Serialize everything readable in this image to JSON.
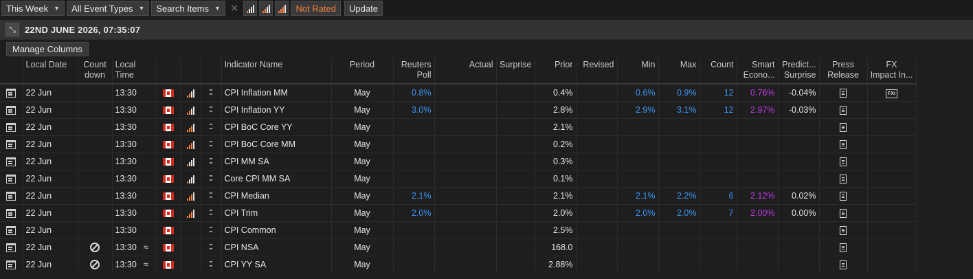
{
  "toolbar": {
    "range_label": "This Week",
    "events_label": "All Event Types",
    "search_label": "Search Items",
    "not_rated_label": "Not Rated",
    "update_label": "Update"
  },
  "datebar": {
    "datetime": "22ND JUNE 2026, 07:35:07"
  },
  "manage_columns_label": "Manage Columns",
  "colors": {
    "blue": "#3d93f0",
    "purple": "#c23de6",
    "orange": "#f2803a"
  },
  "columns": {
    "local_date": "Local Date",
    "countdown_1": "Count",
    "countdown_2": "down",
    "local_time_1": "Local",
    "local_time_2": "Time",
    "indicator": "Indicator Name",
    "period": "Period",
    "poll_1": "Reuters",
    "poll_2": "Poll",
    "actual": "Actual",
    "surprise": "Surprise",
    "prior": "Prior",
    "revised": "Revised",
    "min": "Min",
    "max": "Max",
    "count": "Count",
    "smart_1": "Smart",
    "smart_2": "Econo...",
    "pred_1": "Predict...",
    "pred_2": "Surprise",
    "press_1": "Press",
    "press_2": "Release",
    "fx_1": "FX",
    "fx_2": "Impact In...",
    "fx_icon_label": "FXi"
  },
  "rows": [
    {
      "date": "22 Jun",
      "countdown": "",
      "time": "13:30",
      "approx": "",
      "importance": 2,
      "indicator": "CPI Inflation MM",
      "period": "May",
      "poll": "0.8%",
      "actual": "",
      "surprise": "",
      "prior": "0.4%",
      "revised": "",
      "min": "0.6%",
      "max": "0.9%",
      "count": "12",
      "smart": "0.76%",
      "pred": "-0.04%",
      "fx": true
    },
    {
      "date": "22 Jun",
      "countdown": "",
      "time": "13:30",
      "approx": "",
      "importance": 2,
      "indicator": "CPI Inflation YY",
      "period": "May",
      "poll": "3.0%",
      "actual": "",
      "surprise": "",
      "prior": "2.8%",
      "revised": "",
      "min": "2.9%",
      "max": "3.1%",
      "count": "12",
      "smart": "2.97%",
      "pred": "-0.03%",
      "fx": false
    },
    {
      "date": "22 Jun",
      "countdown": "",
      "time": "13:30",
      "approx": "",
      "importance": 3,
      "indicator": "CPI BoC Core YY",
      "period": "May",
      "poll": "",
      "actual": "",
      "surprise": "",
      "prior": "2.1%",
      "revised": "",
      "min": "",
      "max": "",
      "count": "",
      "smart": "",
      "pred": "",
      "fx": false
    },
    {
      "date": "22 Jun",
      "countdown": "",
      "time": "13:30",
      "approx": "",
      "importance": 3,
      "indicator": "CPI BoC Core MM",
      "period": "May",
      "poll": "",
      "actual": "",
      "surprise": "",
      "prior": "0.2%",
      "revised": "",
      "min": "",
      "max": "",
      "count": "",
      "smart": "",
      "pred": "",
      "fx": false
    },
    {
      "date": "22 Jun",
      "countdown": "",
      "time": "13:30",
      "approx": "",
      "importance": 1,
      "indicator": "CPI MM SA",
      "period": "May",
      "poll": "",
      "actual": "",
      "surprise": "",
      "prior": "0.3%",
      "revised": "",
      "min": "",
      "max": "",
      "count": "",
      "smart": "",
      "pred": "",
      "fx": false
    },
    {
      "date": "22 Jun",
      "countdown": "",
      "time": "13:30",
      "approx": "",
      "importance": 1,
      "indicator": "Core CPI MM SA",
      "period": "May",
      "poll": "",
      "actual": "",
      "surprise": "",
      "prior": "0.1%",
      "revised": "",
      "min": "",
      "max": "",
      "count": "",
      "smart": "",
      "pred": "",
      "fx": false
    },
    {
      "date": "22 Jun",
      "countdown": "",
      "time": "13:30",
      "approx": "",
      "importance": 3,
      "indicator": "CPI Median",
      "period": "May",
      "poll": "2.1%",
      "actual": "",
      "surprise": "",
      "prior": "2.1%",
      "revised": "",
      "min": "2.1%",
      "max": "2.2%",
      "count": "6",
      "smart": "2.12%",
      "pred": "0.02%",
      "fx": false
    },
    {
      "date": "22 Jun",
      "countdown": "",
      "time": "13:30",
      "approx": "",
      "importance": 3,
      "indicator": "CPI Trim",
      "period": "May",
      "poll": "2.0%",
      "actual": "",
      "surprise": "",
      "prior": "2.0%",
      "revised": "",
      "min": "2.0%",
      "max": "2.0%",
      "count": "7",
      "smart": "2.00%",
      "pred": "0.00%",
      "fx": false
    },
    {
      "date": "22 Jun",
      "countdown": "",
      "time": "13:30",
      "approx": "",
      "importance": 0,
      "indicator": "CPI Common",
      "period": "May",
      "poll": "",
      "actual": "",
      "surprise": "",
      "prior": "2.5%",
      "revised": "",
      "min": "",
      "max": "",
      "count": "",
      "smart": "",
      "pred": "",
      "fx": false
    },
    {
      "date": "22 Jun",
      "countdown": "ban",
      "time": "13:30",
      "approx": "≈",
      "importance": 0,
      "indicator": "CPI NSA",
      "period": "May",
      "poll": "",
      "actual": "",
      "surprise": "",
      "prior": "168.0",
      "revised": "",
      "min": "",
      "max": "",
      "count": "",
      "smart": "",
      "pred": "",
      "fx": false
    },
    {
      "date": "22 Jun",
      "countdown": "ban",
      "time": "13:30",
      "approx": "≈",
      "importance": 0,
      "indicator": "CPI YY SA",
      "period": "May",
      "poll": "",
      "actual": "",
      "surprise": "",
      "prior": "2.88%",
      "revised": "",
      "min": "",
      "max": "",
      "count": "",
      "smart": "",
      "pred": "",
      "fx": false
    }
  ]
}
